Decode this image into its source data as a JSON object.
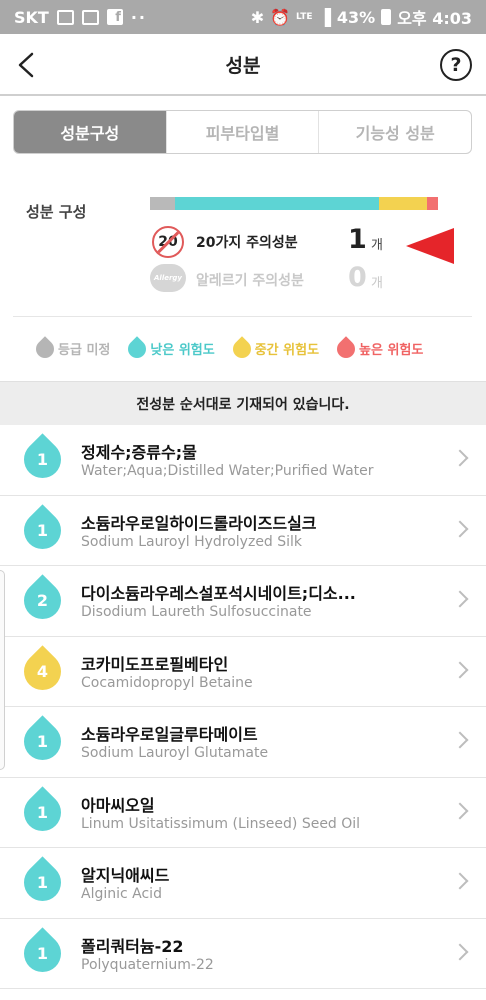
{
  "status_bar": {
    "carrier": "SKT",
    "dots": "··",
    "signal_text": "LTE",
    "battery": "43%",
    "time": "오후 4:03"
  },
  "header": {
    "title": "성분",
    "help_label": "?"
  },
  "tabs": [
    {
      "label": "성분구성",
      "active": true
    },
    {
      "label": "피부타입별",
      "active": false
    },
    {
      "label": "기능성 성분",
      "active": false
    }
  ],
  "composition": {
    "label": "성분 구성",
    "segments": [
      {
        "level": "unrated",
        "color": "#b9b9b9",
        "fraction": 0.09
      },
      {
        "level": "low",
        "color": "#5dd4d4",
        "fraction": 0.73
      },
      {
        "level": "medium",
        "color": "#f3d250",
        "fraction": 0.17
      },
      {
        "level": "high",
        "color": "#f27070",
        "fraction": 0.04
      }
    ],
    "caution20": {
      "badge": "20",
      "label": "20가지 주의성분",
      "count": "1",
      "unit": "개"
    },
    "allergy": {
      "badge": "Allergy",
      "label": "알레르기 주의성분",
      "count": "0",
      "unit": "개"
    }
  },
  "legend": [
    {
      "label": "등급 미정",
      "color": "#b5b5b5",
      "text_color": "#b5b5b5"
    },
    {
      "label": "낮은 위험도",
      "color": "#5dd4d4",
      "text_color": "#4cc9c9"
    },
    {
      "label": "중간 위험도",
      "color": "#f3d250",
      "text_color": "#e7c23a"
    },
    {
      "label": "높은 위험도",
      "color": "#f27070",
      "text_color": "#f06363"
    }
  ],
  "notice": "전성분 순서대로 기재되어 있습니다.",
  "ingredients": [
    {
      "grade": "1",
      "color": "#5dd4d4",
      "name": "정제수;증류수;물",
      "en": "Water;Aqua;Distilled Water;Purified Water"
    },
    {
      "grade": "1",
      "color": "#5dd4d4",
      "name": "소듐라우로일하이드롤라이즈드실크",
      "en": "Sodium Lauroyl Hydrolyzed Silk"
    },
    {
      "grade": "2",
      "color": "#5dd4d4",
      "name": "다이소듐라우레스설포석시네이트;디소...",
      "en": "Disodium Laureth Sulfosuccinate"
    },
    {
      "grade": "4",
      "color": "#f3d250",
      "name": "코카미도프로필베타인",
      "en": "Cocamidopropyl Betaine"
    },
    {
      "grade": "1",
      "color": "#5dd4d4",
      "name": "소듐라우로일글루타메이트",
      "en": "Sodium Lauroyl Glutamate"
    },
    {
      "grade": "1",
      "color": "#5dd4d4",
      "name": "아마씨오일",
      "en": "Linum Usitatissimum (Linseed) Seed Oil"
    },
    {
      "grade": "1",
      "color": "#5dd4d4",
      "name": "알지닉애씨드",
      "en": "Alginic Acid"
    },
    {
      "grade": "1",
      "color": "#5dd4d4",
      "name": "폴리쿼터늄-22",
      "en": "Polyquaternium-22"
    }
  ]
}
